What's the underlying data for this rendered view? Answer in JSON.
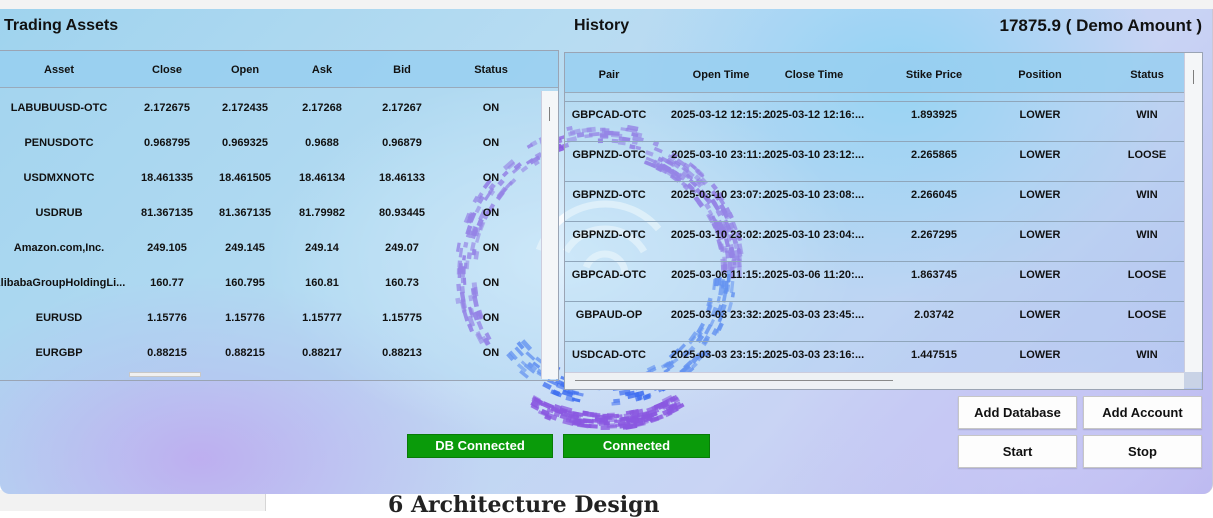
{
  "trading": {
    "title": "Trading Assets",
    "columns": [
      "Asset",
      "Close",
      "Open",
      "Ask",
      "Bid",
      "Status"
    ],
    "rows": [
      [
        "LABUBUUSD-OTC",
        "2.172675",
        "2.172435",
        "2.17268",
        "2.17267",
        "ON"
      ],
      [
        "PENUSDOTC",
        "0.968795",
        "0.969325",
        "0.9688",
        "0.96879",
        "ON"
      ],
      [
        "USDMXNOTC",
        "18.461335",
        "18.461505",
        "18.46134",
        "18.46133",
        "ON"
      ],
      [
        "USDRUB",
        "81.367135",
        "81.367135",
        "81.79982",
        "80.93445",
        "ON"
      ],
      [
        "Amazon.com,Inc.",
        "249.105",
        "249.145",
        "249.14",
        "249.07",
        "ON"
      ],
      [
        "AlibabaGroupHoldingLi...",
        "160.77",
        "160.795",
        "160.81",
        "160.73",
        "ON"
      ],
      [
        "EURUSD",
        "1.15776",
        "1.15776",
        "1.15777",
        "1.15775",
        "ON"
      ],
      [
        "EURGBP",
        "0.88215",
        "0.88215",
        "0.88217",
        "0.88213",
        "ON"
      ]
    ]
  },
  "history": {
    "title": "History",
    "columns": [
      "Pair",
      "Open Time",
      "Close Time",
      "Stike Price",
      "Position",
      "Status"
    ],
    "rows": [
      [
        "GBPCAD-OTC",
        "2025-03-12 12:15:...",
        "2025-03-12 12:16:...",
        "1.893925",
        "LOWER",
        "WIN"
      ],
      [
        "GBPNZD-OTC",
        "2025-03-10 23:11:...",
        "2025-03-10 23:12:...",
        "2.265865",
        "LOWER",
        "LOOSE"
      ],
      [
        "GBPNZD-OTC",
        "2025-03-10 23:07:...",
        "2025-03-10 23:08:...",
        "2.266045",
        "LOWER",
        "WIN"
      ],
      [
        "GBPNZD-OTC",
        "2025-03-10 23:02:...",
        "2025-03-10 23:04:...",
        "2.267295",
        "LOWER",
        "WIN"
      ],
      [
        "GBPCAD-OTC",
        "2025-03-06 11:15:...",
        "2025-03-06 11:20:...",
        "1.863745",
        "LOWER",
        "LOOSE"
      ],
      [
        "GBPAUD-OP",
        "2025-03-03 23:32:...",
        "2025-03-03 23:45:...",
        "2.03742",
        "LOWER",
        "LOOSE"
      ],
      [
        "USDCAD-OTC",
        "2025-03-03 23:15:...",
        "2025-03-03 23:16:...",
        "1.447515",
        "LOWER",
        "WIN"
      ]
    ]
  },
  "balance": "17875.9 ( Demo Amount )",
  "status_labels": {
    "db": "DB Connected",
    "conn": "Connected"
  },
  "buttons": {
    "add_database": "Add Database",
    "add_account": "Add Account",
    "start": "Start",
    "stop": "Stop"
  },
  "colors": {
    "status_green": "#0a9b0a",
    "swirl_purple": "#8a58e0",
    "swirl_blue": "#3f6ef0"
  },
  "background_doc": {
    "heading": "6   Architecture Design"
  }
}
